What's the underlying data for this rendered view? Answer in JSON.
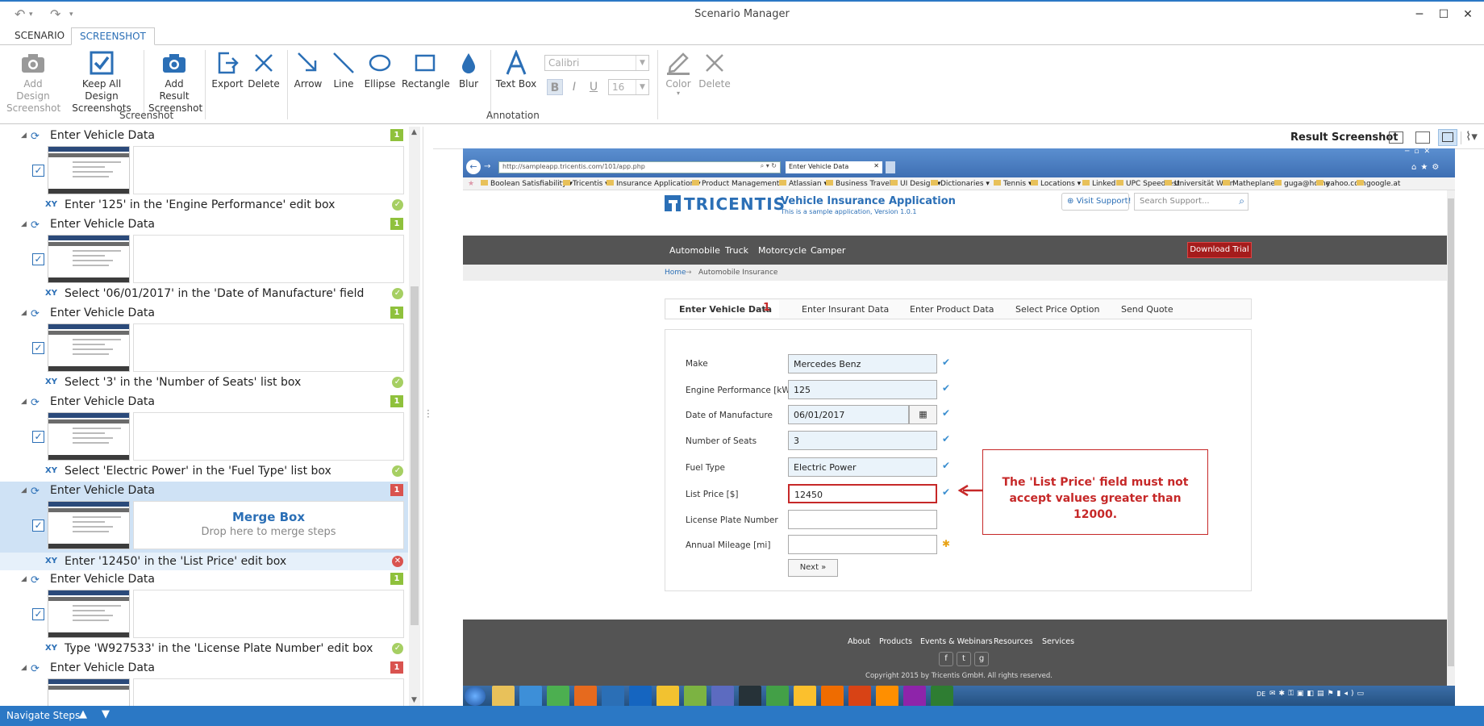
{
  "window": {
    "title": "Scenario Manager"
  },
  "tabs": [
    {
      "label": "SCENARIO"
    },
    {
      "label": "SCREENSHOT"
    }
  ],
  "ribbon": {
    "add_design": "Add Design Screenshot",
    "add_design_l1": "Add Design",
    "add_design_l2": "Screenshot",
    "keep_all_l1": "Keep All Design",
    "keep_all_l2": "Screenshots",
    "add_result_l1": "Add Result",
    "add_result_l2": "Screenshot",
    "export": "Export",
    "delete": "Delete",
    "arrow": "Arrow",
    "line": "Line",
    "ellipse": "Ellipse",
    "rectangle": "Rectangle",
    "blur": "Blur",
    "textbox": "Text Box",
    "font": "Calibri",
    "size": "16",
    "color": "Color",
    "delete2": "Delete",
    "group_screenshot": "Screenshot",
    "group_annotation": "Annotation"
  },
  "steps": [
    {
      "title": "Enter Vehicle Data",
      "badge": "1",
      "action": "Enter '125' in the 'Engine Performance' edit box"
    },
    {
      "title": "Enter Vehicle Data",
      "badge": "1",
      "action": "Select '06/01/2017' in the 'Date of Manufacture' field"
    },
    {
      "title": "Enter Vehicle Data",
      "badge": "1",
      "action": "Select '3' in the 'Number of Seats' list box"
    },
    {
      "title": "Enter Vehicle Data",
      "badge": "1",
      "action": "Select 'Electric Power' in the 'Fuel Type' list box"
    },
    {
      "title": "Enter Vehicle Data",
      "badge": "1",
      "action": "Enter '12450' in the 'List Price' edit box"
    },
    {
      "title": "Enter Vehicle Data",
      "badge": "1",
      "action": "Type 'W927533' in the 'License Plate Number' edit box"
    },
    {
      "title": "Enter Vehicle Data",
      "badge": "1"
    }
  ],
  "merge_box": {
    "title": "Merge Box",
    "hint": "Drop here to merge steps"
  },
  "right_panel": {
    "label": "Result Screenshot"
  },
  "browser": {
    "url": "http://sampleapp.tricentis.com/101/app.php",
    "tab_title": "Enter Vehicle Data",
    "bookmarks": [
      "Boolean Satisfiability",
      "Tricentis",
      "Insurance Application",
      "Product Management",
      "Atlassian",
      "Business Travel",
      "UI Design",
      "Dictionaries",
      "Tennis",
      "Locations",
      "LinkedIn",
      "UPC Speedtest",
      "Universität Wien",
      "Matheplanet",
      "guga@home",
      "yahoo.com",
      "google.at"
    ]
  },
  "app": {
    "logo": "TRICENTIS",
    "title": "Vehicle Insurance Application",
    "subtitle": "This is a sample application, Version 1.0.1",
    "visit_support": "Visit Support!",
    "search_placeholder": "Search Support...",
    "nav": [
      "Automobile",
      "Truck",
      "Motorcycle",
      "Camper"
    ],
    "download": "Download Trial",
    "breadcrumb_home": "Home",
    "breadcrumb_arrow": "→",
    "breadcrumb_current": "Automobile Insurance",
    "wizard": [
      "Enter Vehicle Data",
      "Enter Insurant Data",
      "Enter Product Data",
      "Select Price Option",
      "Send Quote"
    ],
    "wizard_count": "1",
    "fields": [
      {
        "label": "Make",
        "value": "Mercedes Benz"
      },
      {
        "label": "Engine Performance [kW]",
        "value": "125"
      },
      {
        "label": "Date of Manufacture",
        "value": "06/01/2017"
      },
      {
        "label": "Number of Seats",
        "value": "3"
      },
      {
        "label": "Fuel Type",
        "value": "Electric Power"
      },
      {
        "label": "List Price [$]",
        "value": "12450"
      },
      {
        "label": "License Plate Number",
        "value": ""
      },
      {
        "label": "Annual Mileage [mi]",
        "value": ""
      }
    ],
    "next": "Next »",
    "annotation": "The 'List Price' field must not accept values greater than 12000.",
    "footer_links": [
      "About",
      "Products",
      "Events & Webinars",
      "Resources",
      "Services"
    ],
    "copyright": "Copyright 2015 by Tricentis GmbH. All rights reserved."
  },
  "taskbar": {
    "lang": "DE"
  },
  "status": {
    "label": "Navigate Steps"
  },
  "colors": {
    "accent": "#2b78c5",
    "error": "#c62828",
    "ok": "#a6cf63",
    "nav_bg": "#545454",
    "download_bg": "#a51c1c"
  }
}
